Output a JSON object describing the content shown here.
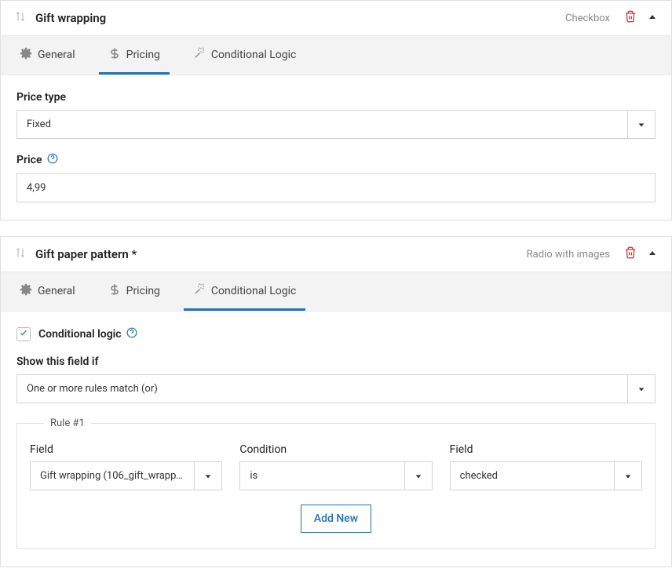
{
  "panel1": {
    "title": "Gift wrapping",
    "type": "Checkbox",
    "tabs": {
      "general": "General",
      "pricing": "Pricing",
      "logic": "Conditional Logic"
    },
    "price_type_label": "Price type",
    "price_type_value": "Fixed",
    "price_label": "Price",
    "price_value": "4,99"
  },
  "panel2": {
    "title": "Gift paper pattern *",
    "type": "Radio with images",
    "tabs": {
      "general": "General",
      "pricing": "Pricing",
      "logic": "Conditional Logic"
    },
    "checkbox_label": "Conditional logic",
    "show_if_label": "Show this field if",
    "show_if_value": "One or more rules match (or)",
    "rule_legend": "Rule #1",
    "col1_label": "Field",
    "col1_value": "Gift wrapping (106_gift_wrappi...",
    "col2_label": "Condition",
    "col2_value": "is",
    "col3_label": "Field",
    "col3_value": "checked",
    "add_new": "Add New"
  }
}
